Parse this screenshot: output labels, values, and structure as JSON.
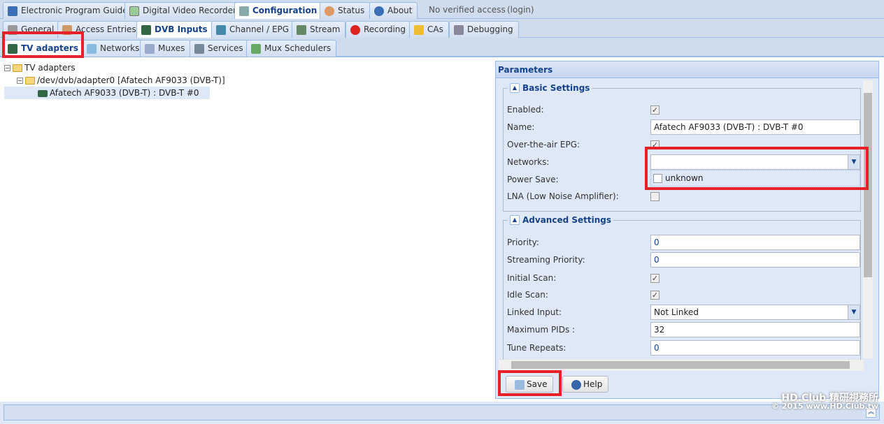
{
  "top_tabs": [
    {
      "label": "Electronic Program Guide",
      "icon": "epg-icon"
    },
    {
      "label": "Digital Video Recorder",
      "icon": "dvr-icon"
    },
    {
      "label": "Configuration",
      "icon": "wrench-icon"
    },
    {
      "label": "Status",
      "icon": "eye-icon"
    },
    {
      "label": "About",
      "icon": "info-icon"
    }
  ],
  "access": {
    "status": "No verified access",
    "login": "(login)"
  },
  "config_tabs": [
    {
      "label": "General"
    },
    {
      "label": "Access Entries"
    },
    {
      "label": "DVB Inputs"
    },
    {
      "label": "Channel / EPG"
    },
    {
      "label": "Stream"
    },
    {
      "label": "Recording"
    },
    {
      "label": "CAs"
    },
    {
      "label": "Debugging"
    }
  ],
  "dvb_tabs": [
    {
      "label": "TV adapters"
    },
    {
      "label": "Networks"
    },
    {
      "label": "Muxes"
    },
    {
      "label": "Services"
    },
    {
      "label": "Mux Schedulers"
    }
  ],
  "tree": {
    "root": "TV adapters",
    "adapter": "/dev/dvb/adapter0 [Afatech AF9033 (DVB-T)]",
    "frontend": "Afatech AF9033 (DVB-T) : DVB-T #0"
  },
  "panel": {
    "title": "Parameters",
    "basic": {
      "title": "Basic Settings",
      "enabled": "Enabled:",
      "name": "Name:",
      "name_value": "Afatech AF9033 (DVB-T) : DVB-T #0",
      "ota_epg": "Over-the-air EPG:",
      "networks": "Networks:",
      "networks_option": "unknown",
      "power_save": "Power Save:",
      "lna": "LNA (Low Noise Amplifier):"
    },
    "advanced": {
      "title": "Advanced Settings",
      "priority": "Priority:",
      "priority_value": "0",
      "streaming_priority": "Streaming Priority:",
      "streaming_priority_value": "0",
      "initial_scan": "Initial Scan:",
      "idle_scan": "Idle Scan:",
      "linked_input": "Linked Input:",
      "linked_input_value": "Not Linked",
      "max_pids": "Maximum PIDs :",
      "max_pids_value": "32",
      "tune_repeats": "Tune Repeats:",
      "tune_repeats_value": "0"
    },
    "save": "Save",
    "help": "Help"
  },
  "watermark": {
    "line1": "HD.Club 精研視務所",
    "line2": "© 2015  www.HD.Club.tw"
  }
}
